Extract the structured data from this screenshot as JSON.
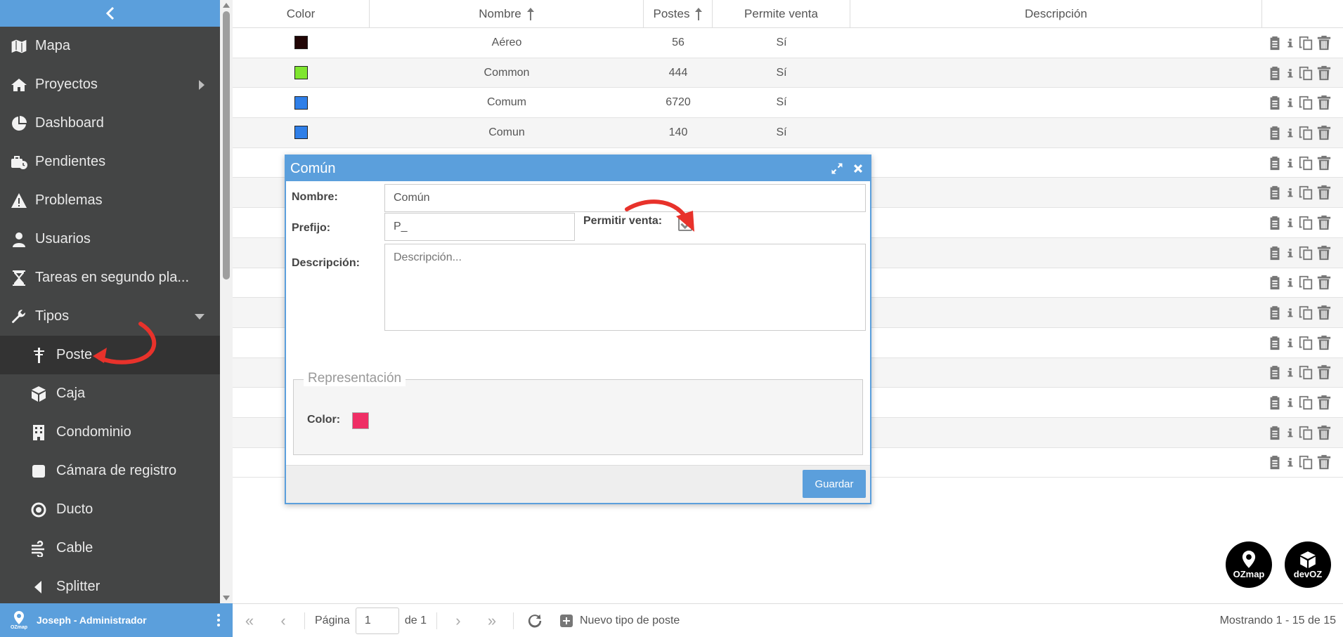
{
  "sidebar": {
    "items": [
      {
        "label": "Mapa",
        "icon": "map-icon"
      },
      {
        "label": "Proyectos",
        "icon": "home-icon"
      },
      {
        "label": "Dashboard",
        "icon": "pie-chart-icon"
      },
      {
        "label": "Pendientes",
        "icon": "toolbox-clock-icon"
      },
      {
        "label": "Problemas",
        "icon": "warning-icon"
      },
      {
        "label": "Usuarios",
        "icon": "user-icon"
      },
      {
        "label": "Tareas en segundo pla...",
        "icon": "hourglass-icon"
      },
      {
        "label": "Tipos",
        "icon": "wrench-icon"
      }
    ],
    "sub_items": [
      {
        "label": "Poste",
        "icon": "pole-icon"
      },
      {
        "label": "Caja",
        "icon": "box-icon"
      },
      {
        "label": "Condominio",
        "icon": "building-icon"
      },
      {
        "label": "Cámara de registro",
        "icon": "square-icon"
      },
      {
        "label": "Ducto",
        "icon": "target-icon"
      },
      {
        "label": "Cable",
        "icon": "cable-icon"
      },
      {
        "label": "Splitter",
        "icon": "caret-left-icon"
      }
    ],
    "footer_user": "Joseph - Administrador",
    "footer_logo": "OZmap"
  },
  "grid": {
    "headers": {
      "color": "Color",
      "nombre": "Nombre",
      "postes": "Postes",
      "venta": "Permite venta",
      "descripcion": "Descripción"
    },
    "rows": [
      {
        "color": "#200505",
        "nombre": "Aéreo",
        "postes": "56",
        "venta": "Sí"
      },
      {
        "color": "#7fe52f",
        "nombre": "Common",
        "postes": "444",
        "venta": "Sí"
      },
      {
        "color": "#2f7fe8",
        "nombre": "Comum",
        "postes": "6720",
        "venta": "Sí"
      },
      {
        "color": "#2f7fe8",
        "nombre": "Comun",
        "postes": "140",
        "venta": "Sí"
      }
    ]
  },
  "pager": {
    "page_label": "Página",
    "page_value": "1",
    "of_label": "de 1",
    "new_label": "Nuevo tipo de poste",
    "summary": "Mostrando 1 - 15 de 15"
  },
  "modal": {
    "title": "Común",
    "nombre_label": "Nombre:",
    "nombre_value": "Común",
    "prefijo_label": "Prefijo:",
    "prefijo_value": "P_",
    "venta_label": "Permitir venta:",
    "descripcion_label": "Descripción:",
    "descripcion_placeholder": "Descripción...",
    "fieldset_legend": "Representación",
    "color_label": "Color:",
    "color_value": "#ef2e65",
    "save_label": "Guardar"
  },
  "brands": {
    "ozmap": "OZmap",
    "devoz": "devOZ"
  },
  "colors": {
    "accent": "#5b9fdc",
    "sidebar_bg": "#444545",
    "annotation": "#e8322b"
  }
}
